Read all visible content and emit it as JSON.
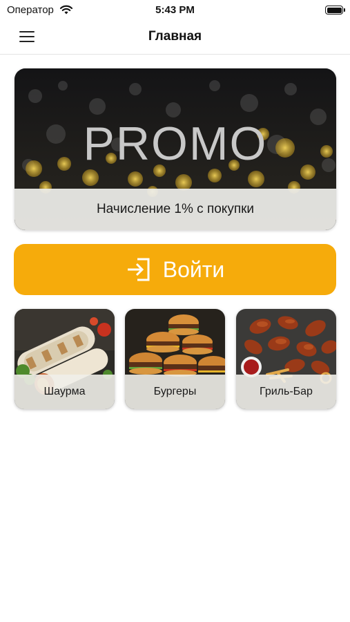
{
  "status_bar": {
    "carrier": "Оператор",
    "time": "5:43 PM"
  },
  "nav": {
    "title": "Главная",
    "menu_icon": "hamburger-menu-icon"
  },
  "promo": {
    "image_text": "PROMO",
    "caption": "Начисление 1% с покупки"
  },
  "login": {
    "label": "Войти",
    "icon": "login-enter-icon",
    "color": "#f6ab0b"
  },
  "categories": [
    {
      "label": "Шаурма"
    },
    {
      "label": "Бургеры"
    },
    {
      "label": "Гриль-Бар"
    }
  ]
}
